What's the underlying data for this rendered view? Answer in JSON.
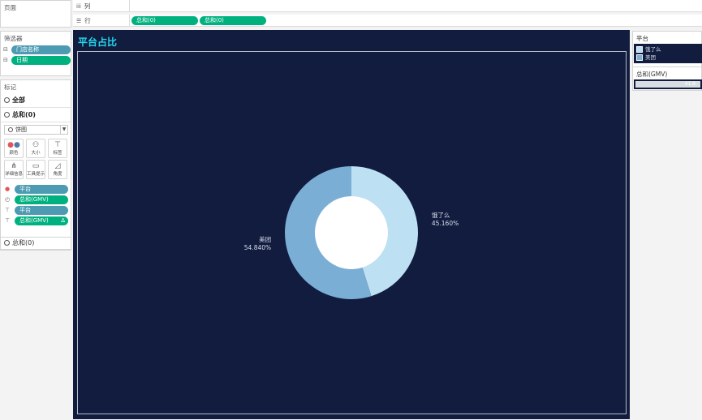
{
  "pages": {
    "title": "页面"
  },
  "filters": {
    "title": "筛选器",
    "items": [
      {
        "label": "门店名称",
        "color": "#4d9bb3"
      },
      {
        "label": "日期",
        "color": "#00b180"
      }
    ]
  },
  "marks": {
    "title": "标记",
    "all_label": "全部",
    "sum_label": "总和(0)",
    "mark_type": "饼图",
    "buttons": [
      "颜色",
      "大小",
      "标签",
      "详细信息",
      "工具提示",
      "角度"
    ],
    "encodings": [
      {
        "icon": "color-dots-icon",
        "label": "平台",
        "color": "#4d9bb3"
      },
      {
        "icon": "angle-icon",
        "label": "总和(GMV)",
        "color": "#00b180"
      },
      {
        "icon": "label-icon",
        "label": "平台",
        "color": "#4d9bb3"
      },
      {
        "icon": "label-icon",
        "label": "总和(GMV)",
        "color": "#00b180",
        "delta": "Δ"
      }
    ],
    "bottom_sum_label": "总和(0)"
  },
  "shelves": {
    "columns_label": "列",
    "rows_label": "行",
    "row_pills": [
      "总和(0)",
      "总和(0)"
    ]
  },
  "legend": {
    "title": "平台",
    "items": [
      {
        "label": "饿了么",
        "color": "#bde0f2"
      },
      {
        "label": "美团",
        "color": "#7aaed4"
      }
    ]
  },
  "size_legend": {
    "title": "总和(GMV)",
    "value": "41.9"
  },
  "chart_data": {
    "type": "pie",
    "title": "平台占比",
    "donut": true,
    "categories": [
      "饿了么",
      "美团"
    ],
    "values": [
      45.16,
      54.84
    ],
    "labels": [
      "45.160%",
      "54.840%"
    ],
    "colors": [
      "#bde0f2",
      "#7aaed4"
    ],
    "background": "#111c3f",
    "title_color": "#25d7ee"
  }
}
